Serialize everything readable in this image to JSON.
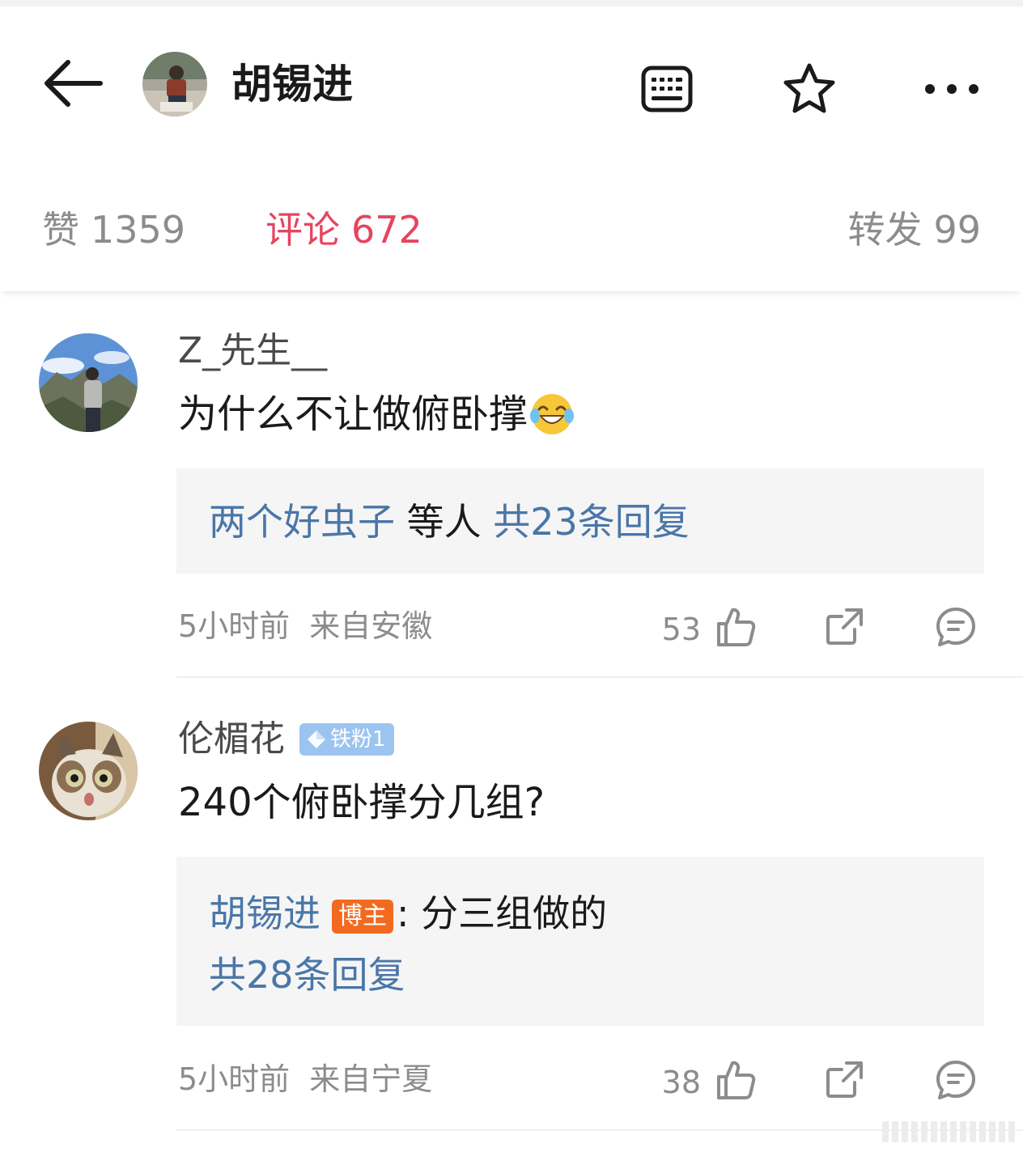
{
  "header": {
    "title": "胡锡进",
    "icons": {
      "back": "back-arrow-icon",
      "timeline": "timeline-icon",
      "favorite": "star-icon",
      "more": "more-icon"
    }
  },
  "stats": {
    "like": {
      "label": "赞",
      "count": "1359"
    },
    "comment": {
      "label": "评论",
      "count": "672",
      "active": true
    },
    "repost": {
      "label": "转发",
      "count": "99"
    }
  },
  "colors": {
    "accent": "#e5455f",
    "link": "#4a76a8",
    "host_badge": "#f26a1f",
    "fans_badge": "#9cc4f0"
  },
  "comments": [
    {
      "username": "Z_先生__",
      "text": "为什么不让做俯卧撑",
      "emoji": "laughing-with-tears-icon",
      "reply_users": "两个好虫子",
      "reply_mid": " 等人 ",
      "reply_total": "共23条回复",
      "time": "5小时前",
      "location": "来自安徽",
      "likes": "53"
    },
    {
      "username": "伦楣花",
      "fans_badge": "铁粉1",
      "text": "240个俯卧撑分几组?",
      "reply_user": "胡锡进",
      "host_badge": "博主",
      "reply_text": ": 分三组做的",
      "reply_total": "共28条回复",
      "time": "5小时前",
      "location": "来自宁夏",
      "likes": "38"
    }
  ]
}
